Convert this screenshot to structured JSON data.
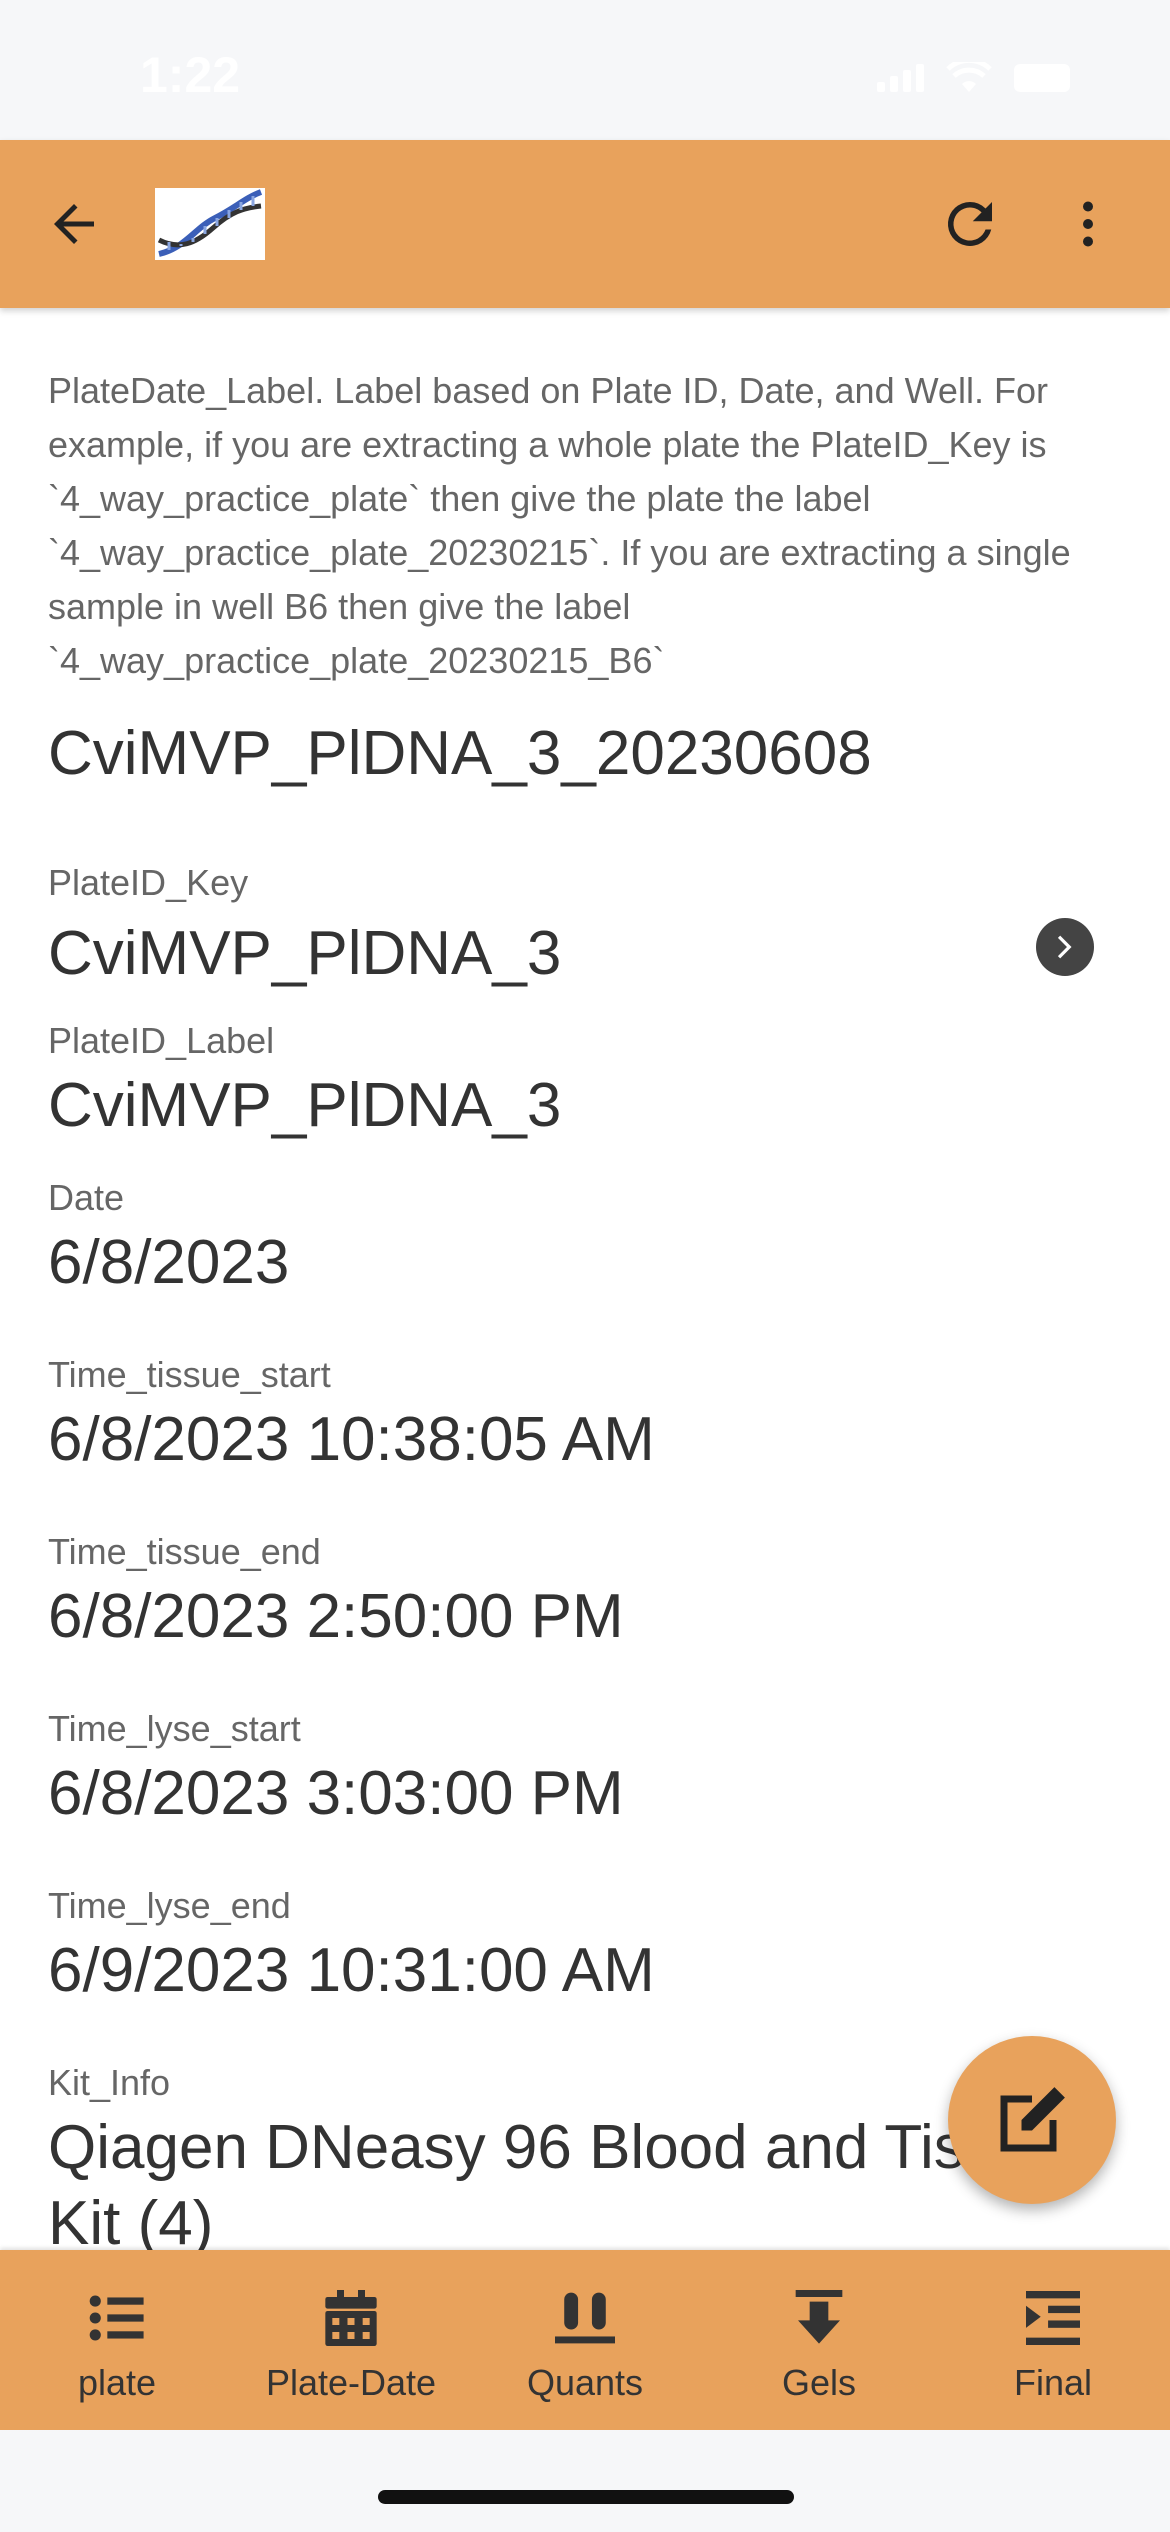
{
  "status_bar": {
    "time": "1:22"
  },
  "app_bar": {
    "back_icon": "arrow-left-icon",
    "logo": "dna-logo",
    "refresh_icon": "refresh-icon",
    "menu_icon": "more-vertical-icon"
  },
  "fields": {
    "platedate_label": {
      "description": "PlateDate_Label. Label based on Plate ID, Date, and Well. For example, if you are extracting a whole plate the PlateID_Key is `4_way_practice_plate` then give the plate the label `4_way_practice_plate_20230215`. If you are extracting a single sample in well B6 then give the label `4_way_practice_plate_20230215_B6`",
      "value": "CviMVP_PlDNA_3_20230608"
    },
    "plateid_key": {
      "label": "PlateID_Key",
      "value": "CviMVP_PlDNA_3"
    },
    "plateid_label": {
      "label": "PlateID_Label",
      "value": "CviMVP_PlDNA_3"
    },
    "date": {
      "label": "Date",
      "value": "6/8/2023"
    },
    "time_tissue_start": {
      "label": "Time_tissue_start",
      "value": "6/8/2023 10:38:05 AM"
    },
    "time_tissue_end": {
      "label": "Time_tissue_end",
      "value": "6/8/2023 2:50:00 PM"
    },
    "time_lyse_start": {
      "label": "Time_lyse_start",
      "value": "6/8/2023 3:03:00 PM"
    },
    "time_lyse_end": {
      "label": "Time_lyse_end",
      "value": "6/9/2023 10:31:00 AM"
    },
    "kit_info": {
      "label": "Kit_Info",
      "value": "Qiagen DNeasy 96 Blood and Tissue Kit (4)"
    }
  },
  "bottom_nav": {
    "items": [
      {
        "label": "plate",
        "icon": "list-icon"
      },
      {
        "label": "Plate-Date",
        "icon": "calendar-icon"
      },
      {
        "label": "Quants",
        "icon": "test-tubes-icon"
      },
      {
        "label": "Gels",
        "icon": "download-arrow-icon"
      },
      {
        "label": "Final",
        "icon": "indent-icon"
      }
    ]
  },
  "colors": {
    "accent": "#e8a25c",
    "text": "#333333",
    "label": "#666666"
  }
}
